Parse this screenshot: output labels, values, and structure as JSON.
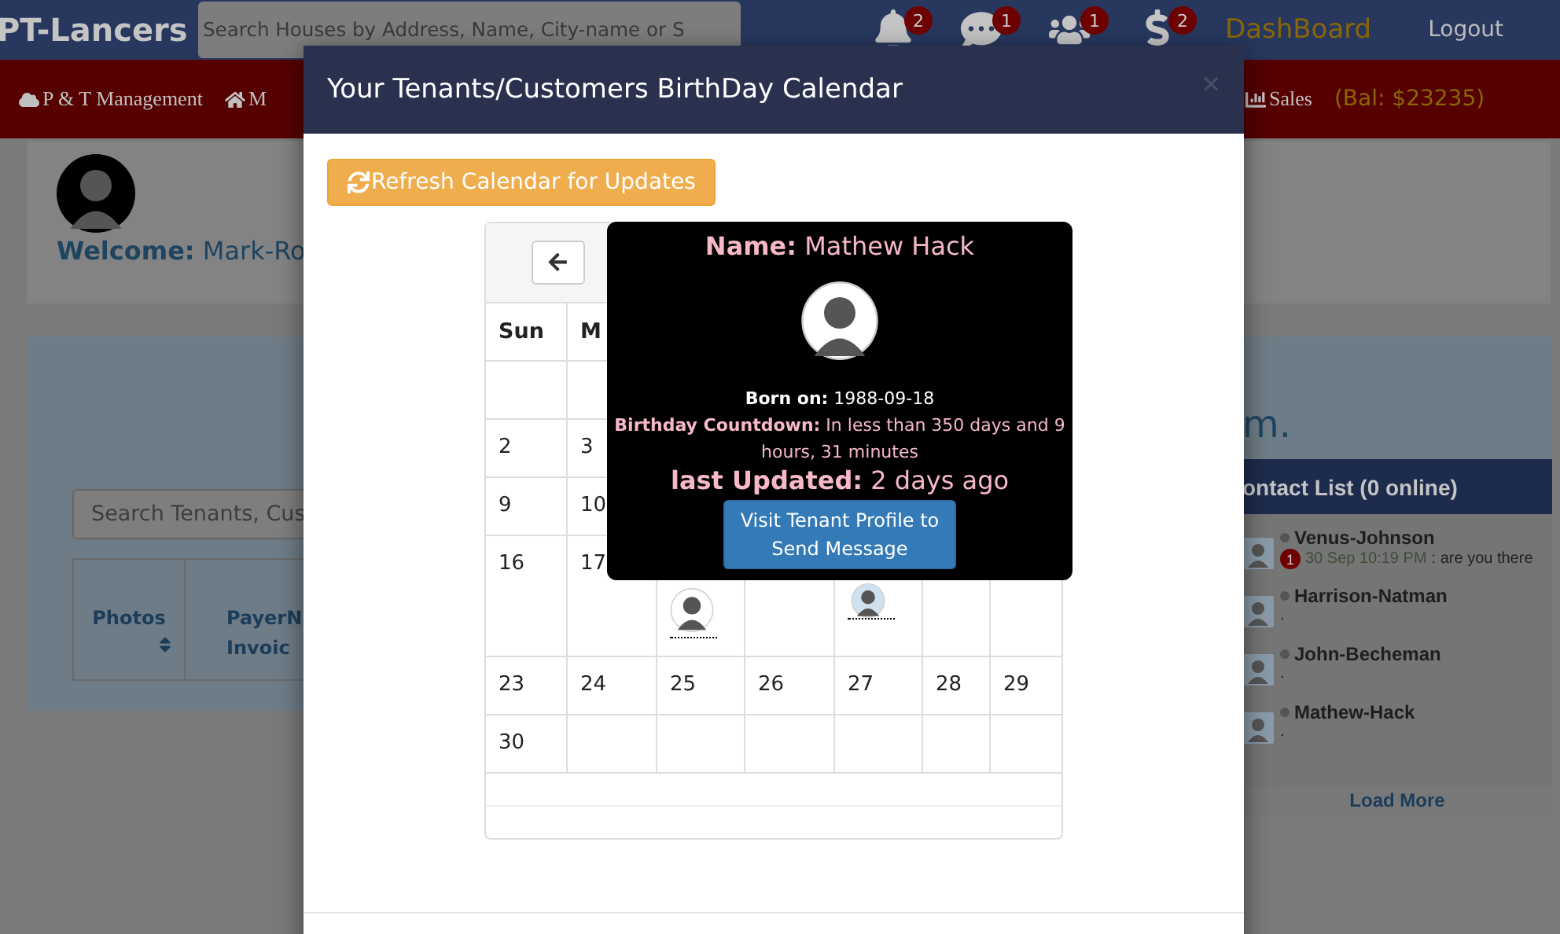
{
  "navbar": {
    "brand": "PT-Lancers",
    "search": {
      "placeholder": "Search Houses by Address, Name, City-name or S"
    },
    "alerts": [
      {
        "kind": "bell",
        "count": "2"
      },
      {
        "kind": "chat",
        "count": "1"
      },
      {
        "kind": "users",
        "count": "1"
      },
      {
        "kind": "dollar",
        "count": "2"
      }
    ],
    "links": [
      "DashBoard",
      "Logout"
    ]
  },
  "menu_bar": {
    "items": [
      {
        "kind": "cloud",
        "label": "P & T Management"
      },
      {
        "kind": "home",
        "label": "M"
      }
    ],
    "right": [
      {
        "kind": "chart",
        "label": "Sales"
      }
    ],
    "balance": "(Bal: $23235)"
  },
  "welcome": {
    "text": "**Welcome:** Mark-Ro"
  },
  "panel": {
    "heading": "m.",
    "search": {
      "placeholder": "Search Tenants, Cus"
    },
    "columns": [
      {
        "label": "Photos",
        "sortable": true
      },
      {
        "label": "PayerN\nInvoic"
      }
    ]
  },
  "contacts": {
    "title": "ontact List (0 online)",
    "items": [
      {
        "name": "Venus-Johnson",
        "online": false,
        "badge": "1",
        "time": "30 Sep 10:19 PM",
        "message": ": are you there"
      },
      {
        "name": "Harrison-Natman",
        "online": false,
        "message": "."
      },
      {
        "name": "John-Becheman",
        "online": false,
        "message": "."
      },
      {
        "name": "Mathew-Hack",
        "online": false,
        "message": "."
      }
    ],
    "load_more": "Load More"
  },
  "modal": {
    "title": "Your Tenants/Customers BirthDay Calendar",
    "close": "×",
    "refresh_button": "Refresh Calendar for Updates",
    "calendar": {
      "weekdays": [
        "Sun",
        "M"
      ],
      "weeks": [
        [
          {
            "kind": "blank"
          }
        ],
        [
          {
            "kind": "day",
            "label": "2"
          },
          {
            "kind": "day",
            "label": "3"
          }
        ],
        [
          {
            "kind": "day",
            "label": "9"
          },
          {
            "kind": "day",
            "label": "10"
          }
        ],
        [
          {
            "kind": "day",
            "label": "16"
          },
          {
            "kind": "day",
            "label": "17"
          },
          {
            "kind": "sketch-avatar"
          },
          {
            "kind": "blank"
          },
          {
            "kind": "photo-avatar"
          }
        ],
        [
          {
            "kind": "day",
            "label": "23"
          },
          {
            "kind": "day",
            "label": "24"
          },
          {
            "kind": "day",
            "label": "25"
          },
          {
            "kind": "day",
            "label": "26"
          },
          {
            "kind": "day",
            "label": "27"
          },
          {
            "kind": "day",
            "label": "28"
          },
          {
            "kind": "day",
            "label": "29"
          }
        ],
        [
          {
            "kind": "day",
            "label": "30"
          }
        ]
      ]
    },
    "popover": {
      "name": "**Name:** Mathew Hack",
      "born": "**Born on:** 1988-09-18",
      "countdown": "**Birthday Countdown:** In less than 350 days and 9 hours, 31 minutes",
      "updated": "**last Updated:** 2 days ago",
      "button": "Visit Tenant Profile to Send Message"
    }
  }
}
